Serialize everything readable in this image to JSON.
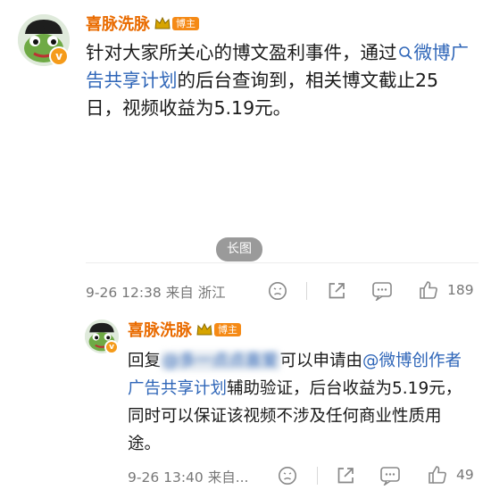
{
  "post": {
    "author": "喜脉洗脉",
    "author_badge": "博主",
    "text_before": "针对大家所关心的博文盈利事件，通过",
    "link_text": "微博广告共享计划",
    "text_after": "的后台查询到，相关博文截止25日，视频收益为5.19元。",
    "long_image_label": "长图",
    "meta": "9-26 12:38 来自 浙江",
    "likes": "189"
  },
  "reply": {
    "author": "喜脉洗脉",
    "author_badge": "博主",
    "text_prefix": "回复",
    "mention_blurred": "@多一点点喜爱",
    "text_mid": "可以申请由",
    "mention_link": "@微博创作者广告共享计划",
    "text_after": "辅助验证，后台收益为5.19元，同时可以保证该视频不涉及任何商业性质用途。",
    "meta": "9-26 13:40 来自...",
    "likes": "49"
  },
  "icons": {
    "search": "search-icon",
    "emoji": "emoji-face-icon",
    "share": "share-icon",
    "comment": "comment-icon",
    "like": "like-thumb-icon",
    "verified": "verified-v-icon",
    "crown": "crown-level-icon"
  },
  "colors": {
    "username": "#e96b00",
    "link": "#2f66b8",
    "badge": "#f58a16",
    "meta_gray": "#777777"
  }
}
